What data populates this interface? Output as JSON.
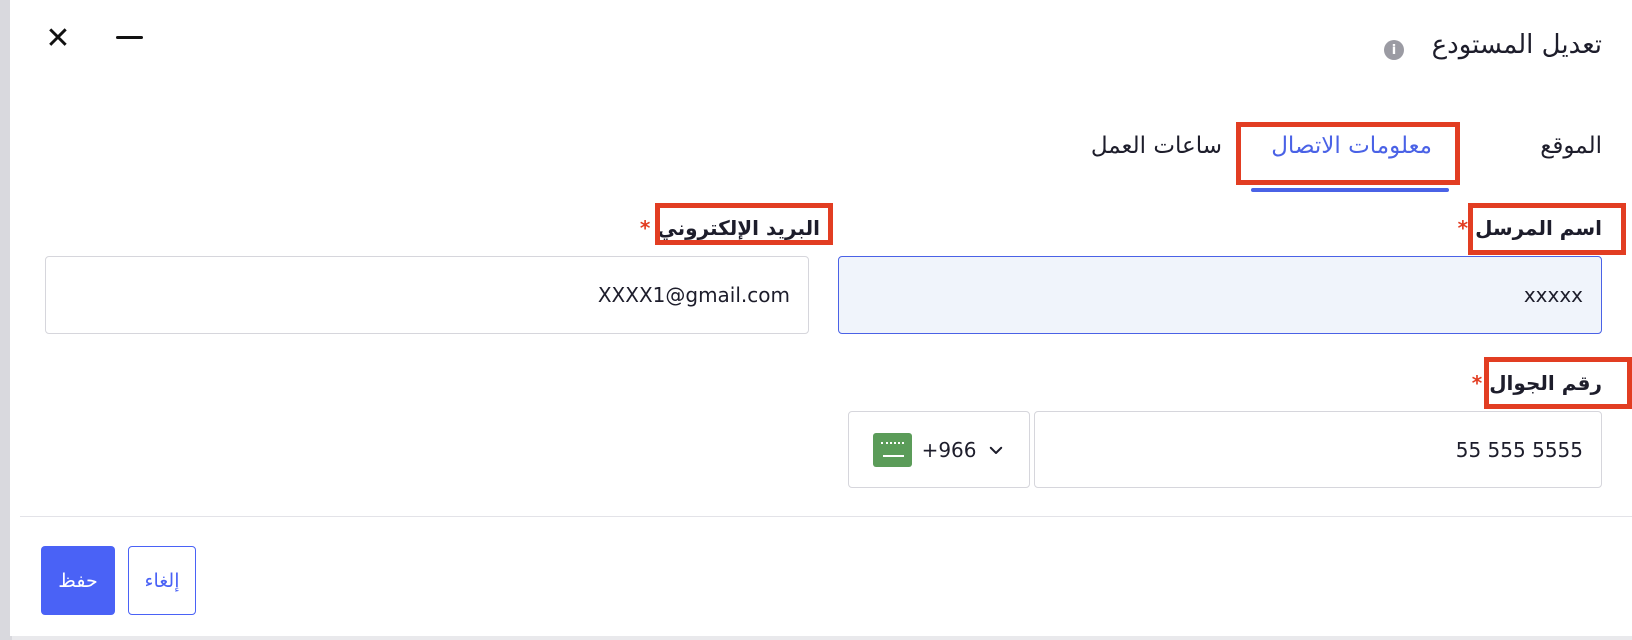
{
  "dialog": {
    "title": "تعديل المستودع",
    "info_icon": "info-icon",
    "close_icon": "close-icon",
    "minimize_icon": "minimize-icon"
  },
  "tabs": [
    {
      "label": "الموقع",
      "active": false
    },
    {
      "label": "معلومات الاتصال",
      "active": true
    },
    {
      "label": "ساعات العمل",
      "active": false
    }
  ],
  "form": {
    "sender_name": {
      "label": "اسم المرسل",
      "required_mark": "*",
      "value": "xxxxx"
    },
    "email": {
      "label": "البريد الإلكتروني",
      "required_mark": "*",
      "value": "XXXX1@gmail.com"
    },
    "mobile": {
      "label": "رقم الجوال",
      "required_mark": "*",
      "value": "55 555 5555",
      "dial_code": "+966",
      "flag_icon": "saudi-flag-icon"
    }
  },
  "actions": {
    "save_label": "حفظ",
    "cancel_label": "إلغاء"
  },
  "colors": {
    "accent": "#4a62f6",
    "highlight": "#e23d22",
    "required": "#e23d22"
  }
}
